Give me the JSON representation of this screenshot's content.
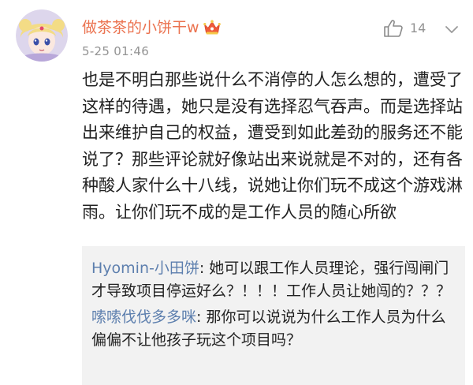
{
  "comment": {
    "username": "做茶茶的小饼干w",
    "badge_icon": "crown-icon",
    "timestamp": "5-25 01:46",
    "like_icon": "thumbs-up-icon",
    "like_count": "14",
    "more_icon": "chevron-down-icon",
    "body": "也是不明白那些说什么不消停的人怎么想的，遭受了这样的待遇，她只是没有选择忍气吞声。而是选择站出来维护自己的权益，遭受到如此差劲的服务还不能说了？那些评论就好像站出来说就是不对的，还有各种酸人家什么十八线，说她让你们玩不成这个游戏淋雨。让你们玩不成的是工作人员的随心所欲"
  },
  "replies": [
    {
      "author": "Hyomin-小田饼",
      "separator": ": ",
      "text": "她可以跟工作人员理论，强行闯闸门才导致项目停运好么？！！！工作人员让她闯的？？？"
    },
    {
      "author": "嗦嗦伐伐多多咪",
      "separator": ": ",
      "text": "那你可以说说为什么工作人员为什么偏偏不让他孩子玩这个项目吗？"
    }
  ],
  "colors": {
    "username": "#eb7350",
    "reply_author": "#5d7fae",
    "meta_gray": "#939393",
    "reply_bg": "#f2f2f2"
  }
}
